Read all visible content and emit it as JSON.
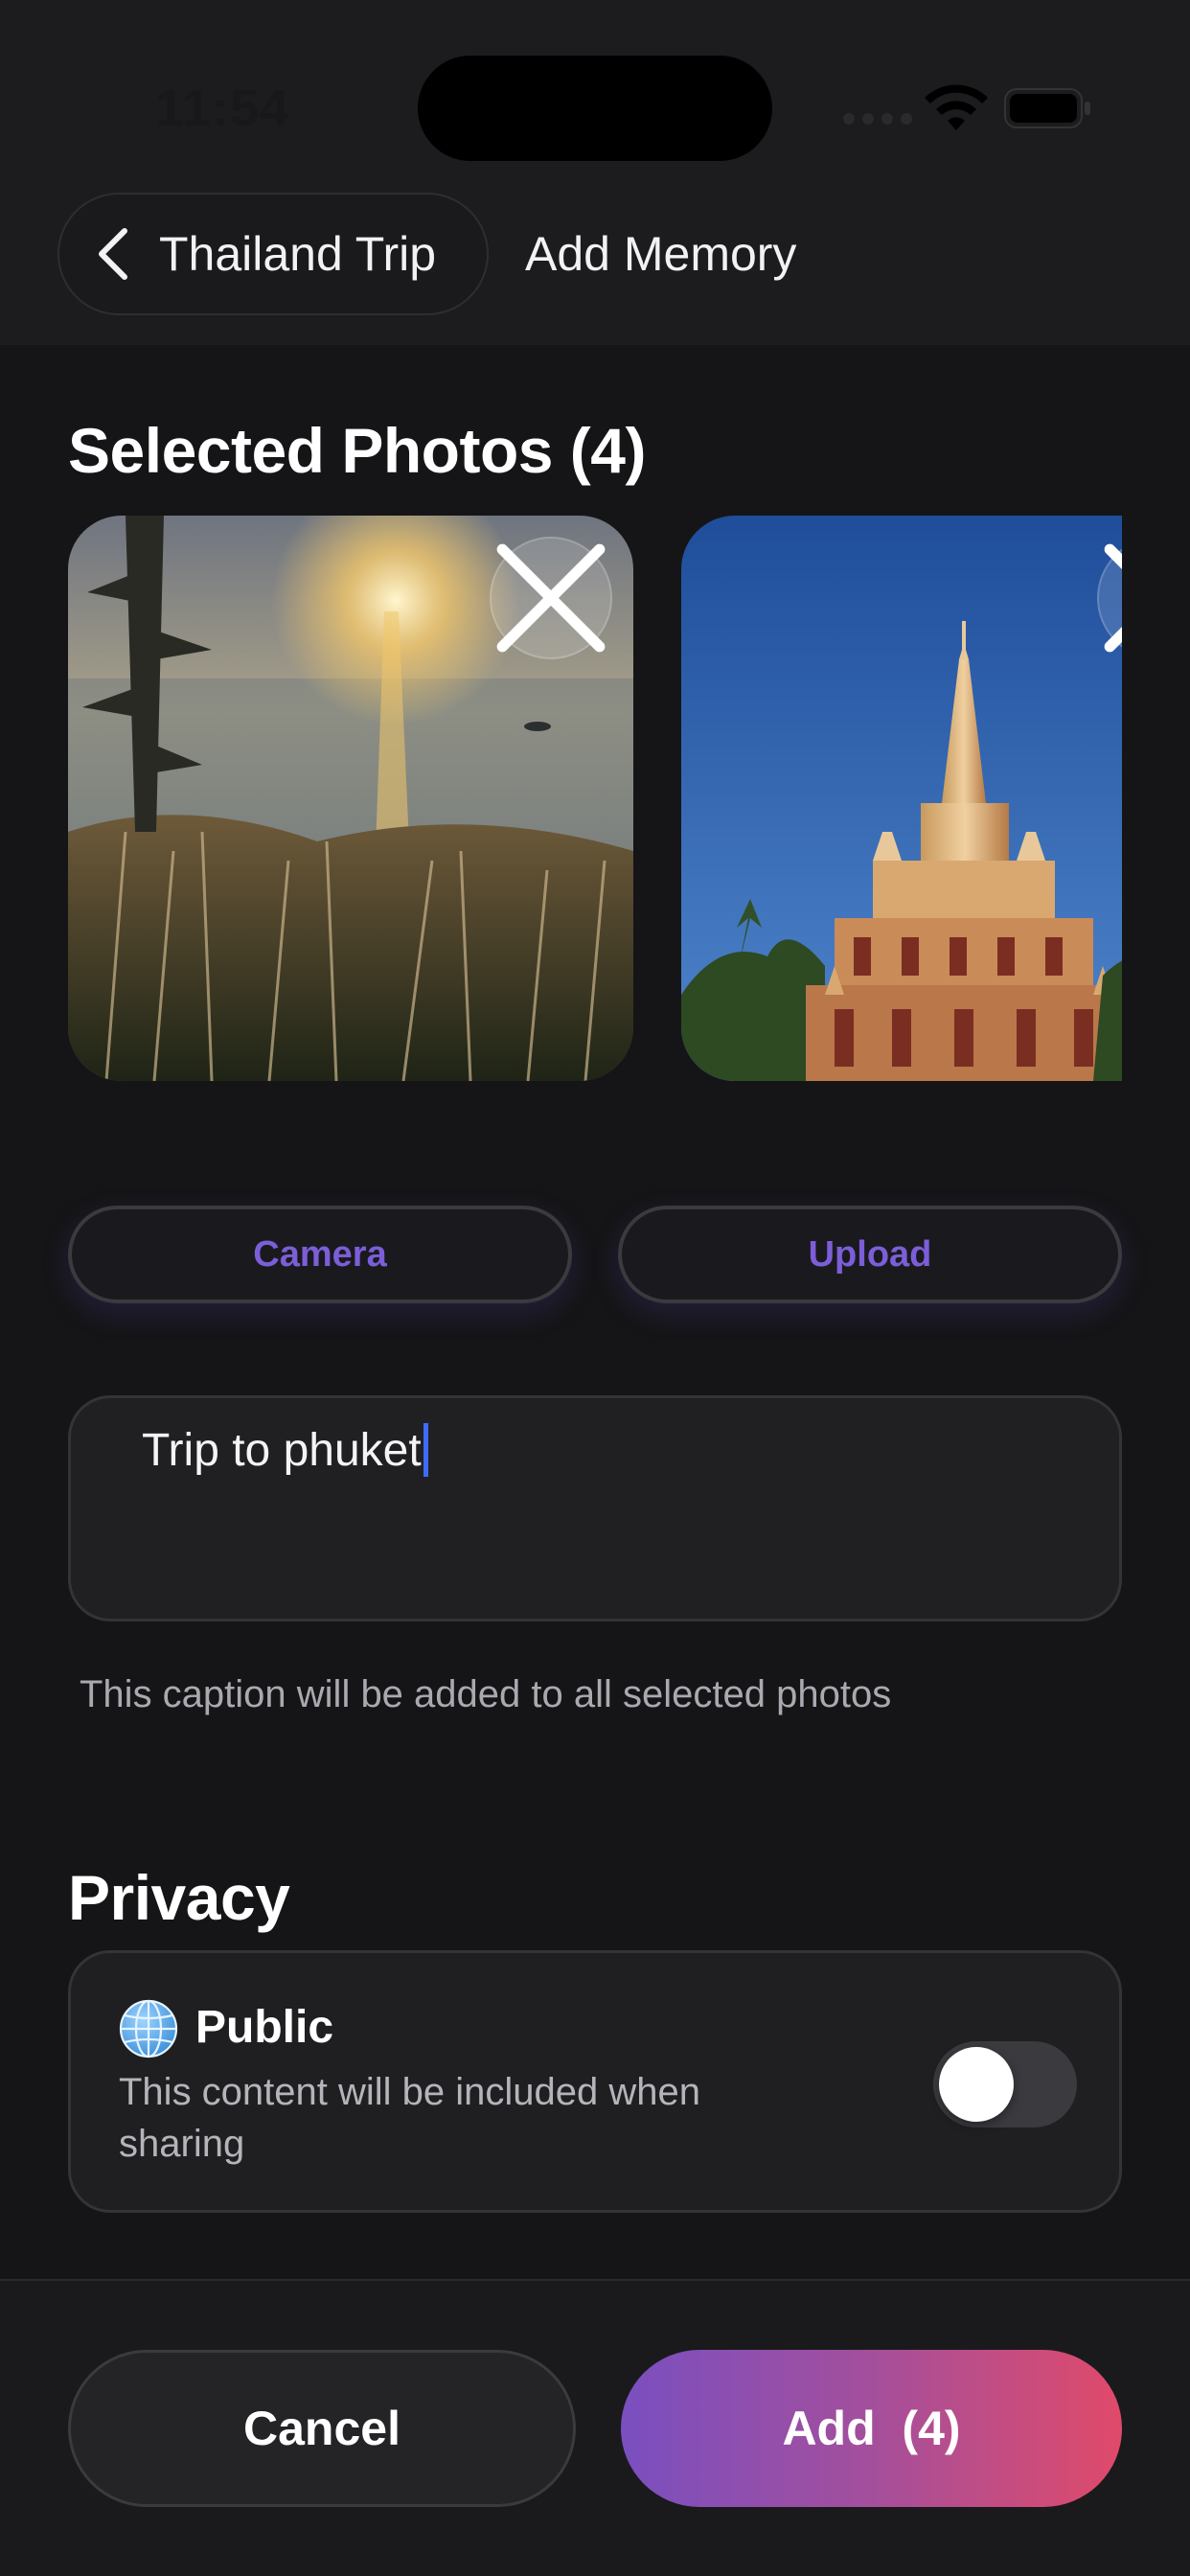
{
  "status_bar": {
    "time": "11:54"
  },
  "nav": {
    "back_label": "Thailand Trip",
    "title": "Add Memory"
  },
  "photos": {
    "heading": "Selected Photos (4)",
    "items": [
      {
        "subject": "sunset over sea with palm tree",
        "icon": "close-icon"
      },
      {
        "subject": "temple pagoda under blue sky",
        "icon": "close-icon"
      }
    ]
  },
  "actions": {
    "camera_label": "Camera",
    "upload_label": "Upload"
  },
  "caption": {
    "value": "Trip to phuket",
    "hint": "This caption will be added to all selected photos"
  },
  "privacy": {
    "heading": "Privacy",
    "option_label": "Public",
    "option_icon": "globe-icon",
    "description": "This content will be included when sharing",
    "enabled": false
  },
  "footer": {
    "cancel_label": "Cancel",
    "add_label": "Add  (4)"
  },
  "colors": {
    "accent": "#7c5ed8",
    "gradient_start": "#7a4fc0",
    "gradient_end": "#e04a6a",
    "background": "#151517"
  }
}
